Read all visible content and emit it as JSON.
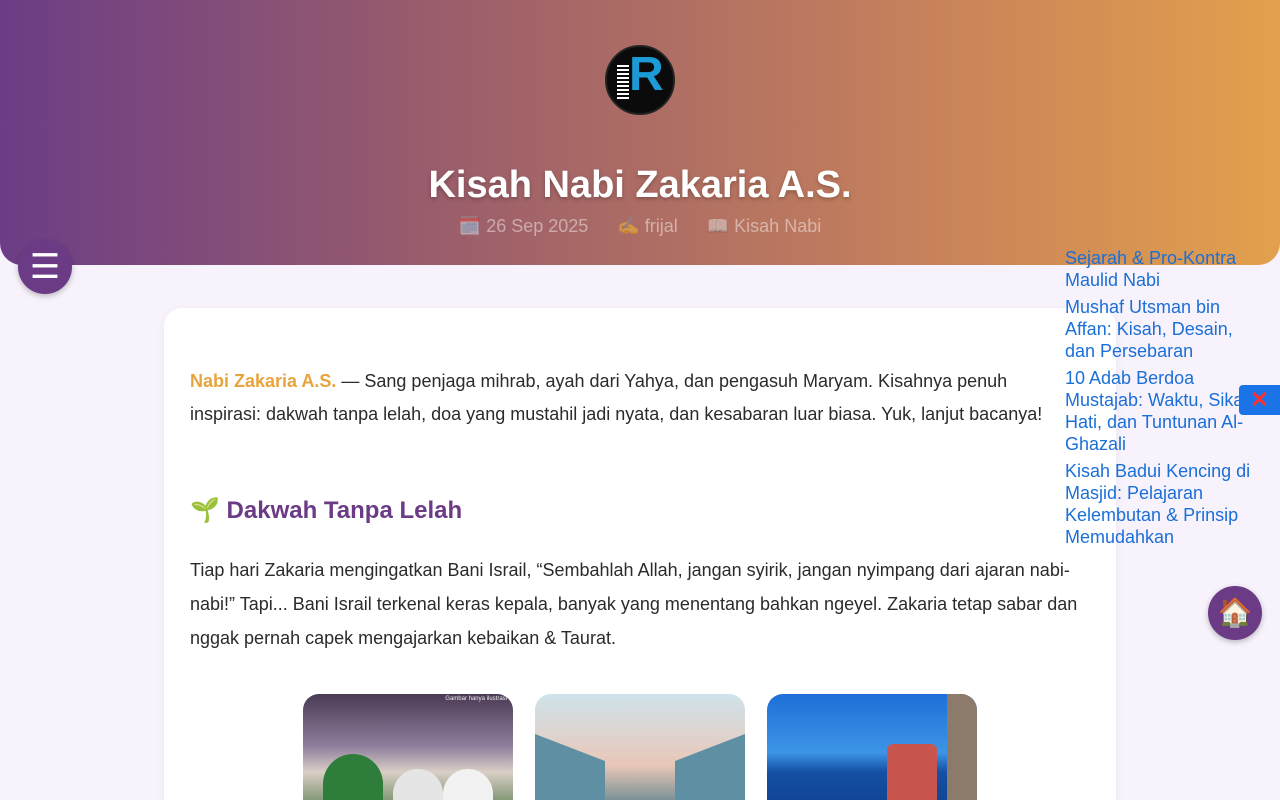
{
  "header": {
    "title": "Kisah Nabi Zakaria A.S.",
    "date": "🗓️ 26 Sep 2025",
    "author": "✍️ frijal",
    "category": "📖 Kisah Nabi",
    "logo_icon": "site-logo"
  },
  "nav": {
    "menu_icon": "☰",
    "home_icon": "🏠",
    "close_icon": "✕"
  },
  "article": {
    "intro_highlight": "Nabi Zakaria A.S.",
    "intro_text": " — Sang penjaga mihrab, ayah dari Yahya, dan pengasuh Maryam. Kisahnya penuh inspirasi: dakwah tanpa lelah, doa yang mustahil jadi nyata, dan kesabaran luar biasa. Yuk, lanjut bacanya!",
    "section1_heading": "🌱 Dakwah Tanpa Lelah",
    "section1_text": "Tiap hari Zakaria mengingatkan Bani Israil, “Sembahlah Allah, jangan syirik, jangan nyimpang dari ajaran nabi-nabi!” Tapi... Bani Israil terkenal keras kepala, banyak yang menentang bahkan ngeyel. Zakaria tetap sabar dan nggak pernah capek mengajarkan kebaikan & Taurat.",
    "thumb1_caption": "Gambar hanya ilustrasi"
  },
  "related": [
    "Sejarah & Pro-Kontra Maulid Nabi",
    "Mushaf Utsman bin Affan: Kisah, Desain, dan Persebaran",
    "10 Adab Berdoa Mustajab: Waktu, Sikap Hati, dan Tuntunan Al-Ghazali",
    "Kisah Badui Kencing di Masjid: Pelajaran Kelembutan & Prinsip Memudahkan"
  ],
  "colors": {
    "accent": "#6b3b86",
    "highlight": "#e8a43c",
    "link": "#1a6fd8"
  }
}
